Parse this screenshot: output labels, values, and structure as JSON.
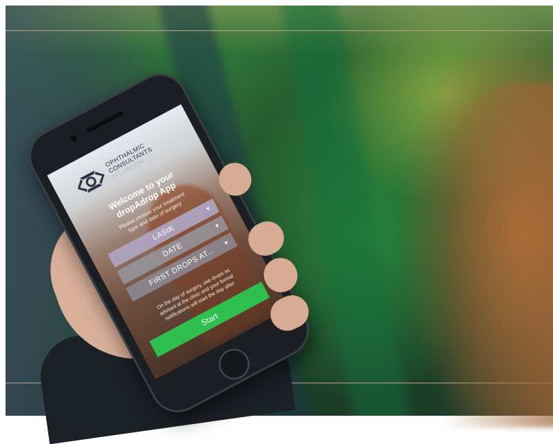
{
  "brand": {
    "line1": "OPHTHALMIC",
    "line2": "CONSULTANTS",
    "line3": "of LONDON"
  },
  "welcome": {
    "line1": "Welcome to your",
    "line2": "dropAdrop App"
  },
  "intro": {
    "line1": "Please choose your treatment",
    "line2": "type and date of surgery"
  },
  "selects": {
    "treatment": "LASIK",
    "date": "DATE",
    "first_drops": "FIRST DROPS AT..."
  },
  "note": {
    "line1": "On the day of surgery, use drops as",
    "line2": "advised at the clinic and your formal",
    "line3": "notifications will start the day after"
  },
  "start_label": "Start",
  "colors": {
    "start_button": "#2ebf4f",
    "logo": "#2b2f45",
    "treatment_select": "#afa5c3"
  }
}
